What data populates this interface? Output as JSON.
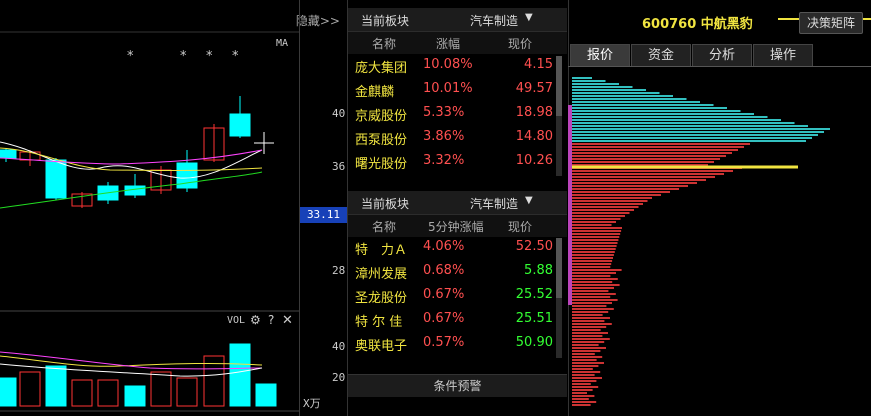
{
  "chart": {
    "hide_link": "隐藏>>",
    "ma_label": "MA",
    "stars": [
      "*",
      "*",
      "*",
      "*",
      "*"
    ],
    "y_labels": [
      "40",
      "36",
      "28"
    ],
    "current_price": "33.11",
    "vol_label": "VOL",
    "vol_y_labels": [
      "40",
      "20"
    ],
    "vol_unit": "X万",
    "colors": {
      "up": "#ff3333",
      "down": "#00ffff",
      "ma1": "#ffffff",
      "ma2": "#f0e440",
      "ma3": "#ff44ff",
      "ma4": "#22dd22"
    }
  },
  "panel1": {
    "label": "当前板块",
    "sector": "汽车制造",
    "columns": [
      "名称",
      "涨幅",
      "现价"
    ],
    "rows": [
      {
        "name": "庞大集团",
        "pct": "10.08%",
        "price": "4.15",
        "price_color": "#ff5050"
      },
      {
        "name": "金麒麟",
        "pct": "10.01%",
        "price": "49.57",
        "price_color": "#ff5050"
      },
      {
        "name": "京威股份",
        "pct": "5.33%",
        "price": "18.98",
        "price_color": "#ff5050"
      },
      {
        "name": "西泵股份",
        "pct": "3.86%",
        "price": "14.80",
        "price_color": "#ff5050"
      },
      {
        "name": "曙光股份",
        "pct": "3.32%",
        "price": "10.26",
        "price_color": "#ff5050"
      }
    ]
  },
  "panel2": {
    "label": "当前板块",
    "sector": "汽车制造",
    "columns": [
      "名称",
      "5分钟涨幅",
      "现价"
    ],
    "rows": [
      {
        "name": "特　力Ａ",
        "pct": "4.06%",
        "price": "52.50",
        "price_color": "#ff5050"
      },
      {
        "name": "漳州发展",
        "pct": "0.68%",
        "price": "5.88",
        "price_color": "#33ff33"
      },
      {
        "name": "圣龙股份",
        "pct": "0.67%",
        "price": "25.52",
        "price_color": "#33ff33"
      },
      {
        "name": "特 尔 佳",
        "pct": "0.67%",
        "price": "25.51",
        "price_color": "#33ff33"
      },
      {
        "name": "奥联电子",
        "pct": "0.57%",
        "price": "50.90",
        "price_color": "#33ff33"
      }
    ]
  },
  "condition_alert": "条件预警",
  "right": {
    "title": "600760 中航黑豹",
    "decision_button": "决策矩阵",
    "tabs": [
      "报价",
      "资金",
      "分析",
      "操作"
    ],
    "active_tab": 0
  }
}
